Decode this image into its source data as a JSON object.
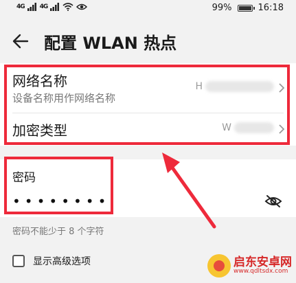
{
  "status_bar": {
    "signal1": "4G",
    "signal2": "4G",
    "battery": "99%",
    "time": "16:18"
  },
  "header": {
    "title": "配置 WLAN 热点"
  },
  "network_name": {
    "label": "网络名称",
    "subtitle": "设备名称用作网络名称",
    "value": "H"
  },
  "encryption": {
    "label": "加密类型",
    "value": "W"
  },
  "password": {
    "label": "密码",
    "value": "••••••••"
  },
  "hint": "密码不能少于 8 个字符",
  "advanced_option": {
    "label": "显示高级选项"
  },
  "watermark": {
    "title": "启东安卓网",
    "url": "www.qdltsdx.com"
  },
  "colors": {
    "annotation_red": "#ee2a3b",
    "background": "#f2f2f2",
    "card": "#ffffff"
  },
  "icons": [
    "back-arrow-icon",
    "chevron-right-icon",
    "eye-slash-icon",
    "wifi-icon",
    "eye-icon",
    "battery-icon"
  ]
}
